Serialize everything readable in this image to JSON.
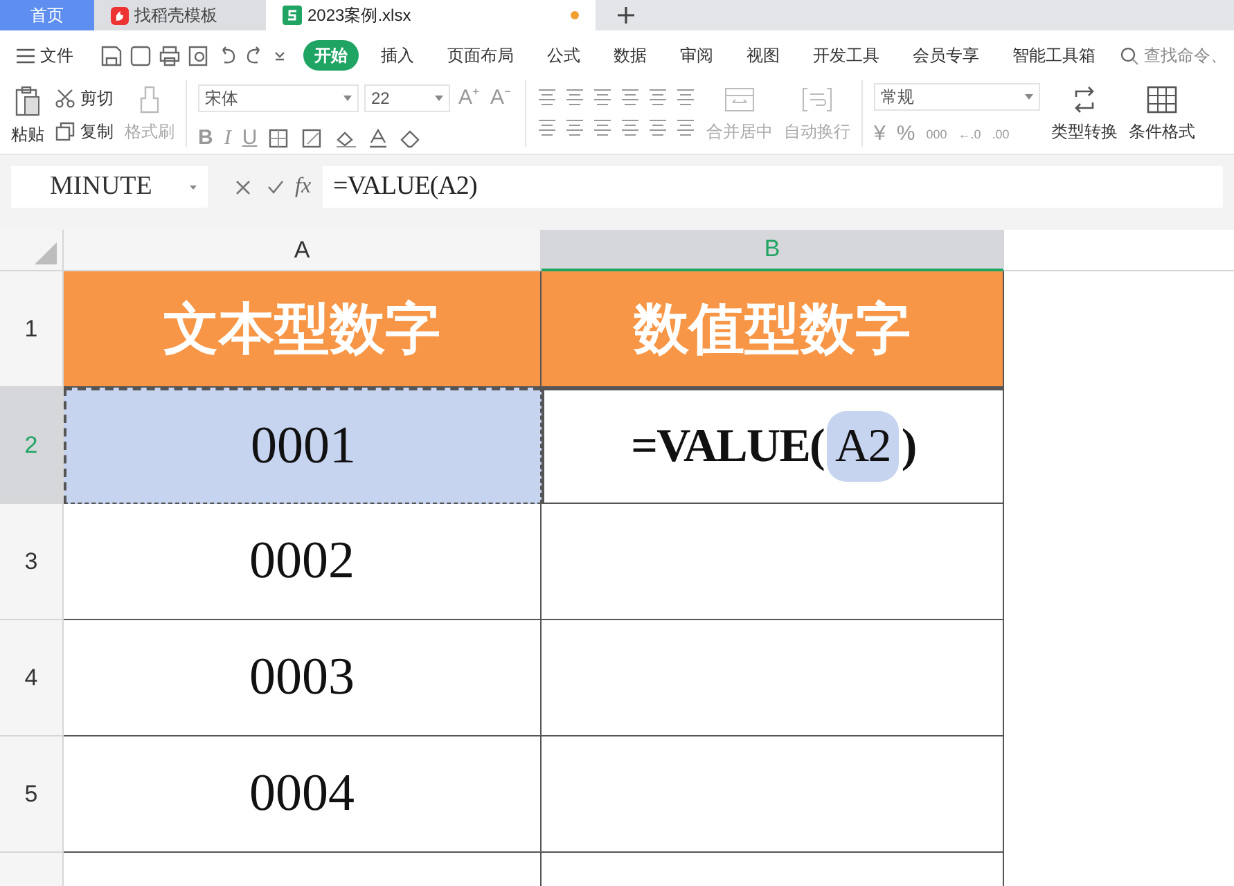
{
  "tabs": [
    {
      "label": "首页",
      "kind": "home",
      "selected": false
    },
    {
      "label": "找稻壳模板",
      "kind": "template",
      "selected": false
    },
    {
      "label": "2023案例.xlsx",
      "kind": "file",
      "selected": true
    }
  ],
  "menu": {
    "file_label": "文件",
    "items": [
      {
        "label": "开始",
        "selected": true
      },
      {
        "label": "插入",
        "selected": false
      },
      {
        "label": "页面布局",
        "selected": false
      },
      {
        "label": "公式",
        "selected": false
      },
      {
        "label": "数据",
        "selected": false
      },
      {
        "label": "审阅",
        "selected": false
      },
      {
        "label": "视图",
        "selected": false
      },
      {
        "label": "开发工具",
        "selected": false
      },
      {
        "label": "会员专享",
        "selected": false
      },
      {
        "label": "智能工具箱",
        "selected": false
      }
    ],
    "search": {
      "placeholder": "查找命令、"
    }
  },
  "ribbon": {
    "paste": "粘贴",
    "cut": "剪切",
    "copy": "复制",
    "format_painter": {
      "label": "格式刷",
      "disabled": true
    },
    "font_name": "宋体",
    "font_size": "22",
    "size_buttons": [
      "A⁺",
      "A⁻"
    ],
    "style_buttons": [
      "B",
      "I",
      "U"
    ],
    "merge": {
      "label": "合并居中",
      "disabled": true
    },
    "wrap": {
      "label": "自动换行",
      "disabled": true
    },
    "number_format": "常规",
    "number_buttons": [
      "¥",
      "%",
      "000",
      "←.0",
      ".00"
    ],
    "convert": {
      "label": "类型转换",
      "disabled": false
    },
    "conditional": {
      "label": "条件格式",
      "disabled": false
    }
  },
  "formula_bar": {
    "name_box": "MINUTE",
    "fx": "fx",
    "formula": "=VALUE(A2)"
  },
  "sheet": {
    "columns": [
      {
        "label": "A",
        "selected": false
      },
      {
        "label": "B",
        "selected": true
      }
    ],
    "rows": [
      {
        "number": "1",
        "selected": false,
        "cells": [
          {
            "kind": "header",
            "text": "文本型数字"
          },
          {
            "kind": "header",
            "text": "数值型数字"
          }
        ]
      },
      {
        "number": "2",
        "selected": true,
        "cells": [
          {
            "kind": "value",
            "text": "0001",
            "marked": true
          },
          {
            "kind": "formula",
            "text": "=VALUE(",
            "ref": "A2",
            "tail": ")"
          }
        ]
      },
      {
        "number": "3",
        "selected": false,
        "cells": [
          {
            "kind": "value",
            "text": "0002",
            "marked": false
          },
          {
            "kind": "empty"
          }
        ]
      },
      {
        "number": "4",
        "selected": false,
        "cells": [
          {
            "kind": "value",
            "text": "0003",
            "marked": false
          },
          {
            "kind": "empty"
          }
        ]
      },
      {
        "number": "5",
        "selected": false,
        "cells": [
          {
            "kind": "value",
            "text": "0004",
            "marked": false
          },
          {
            "kind": "empty"
          }
        ]
      }
    ]
  }
}
